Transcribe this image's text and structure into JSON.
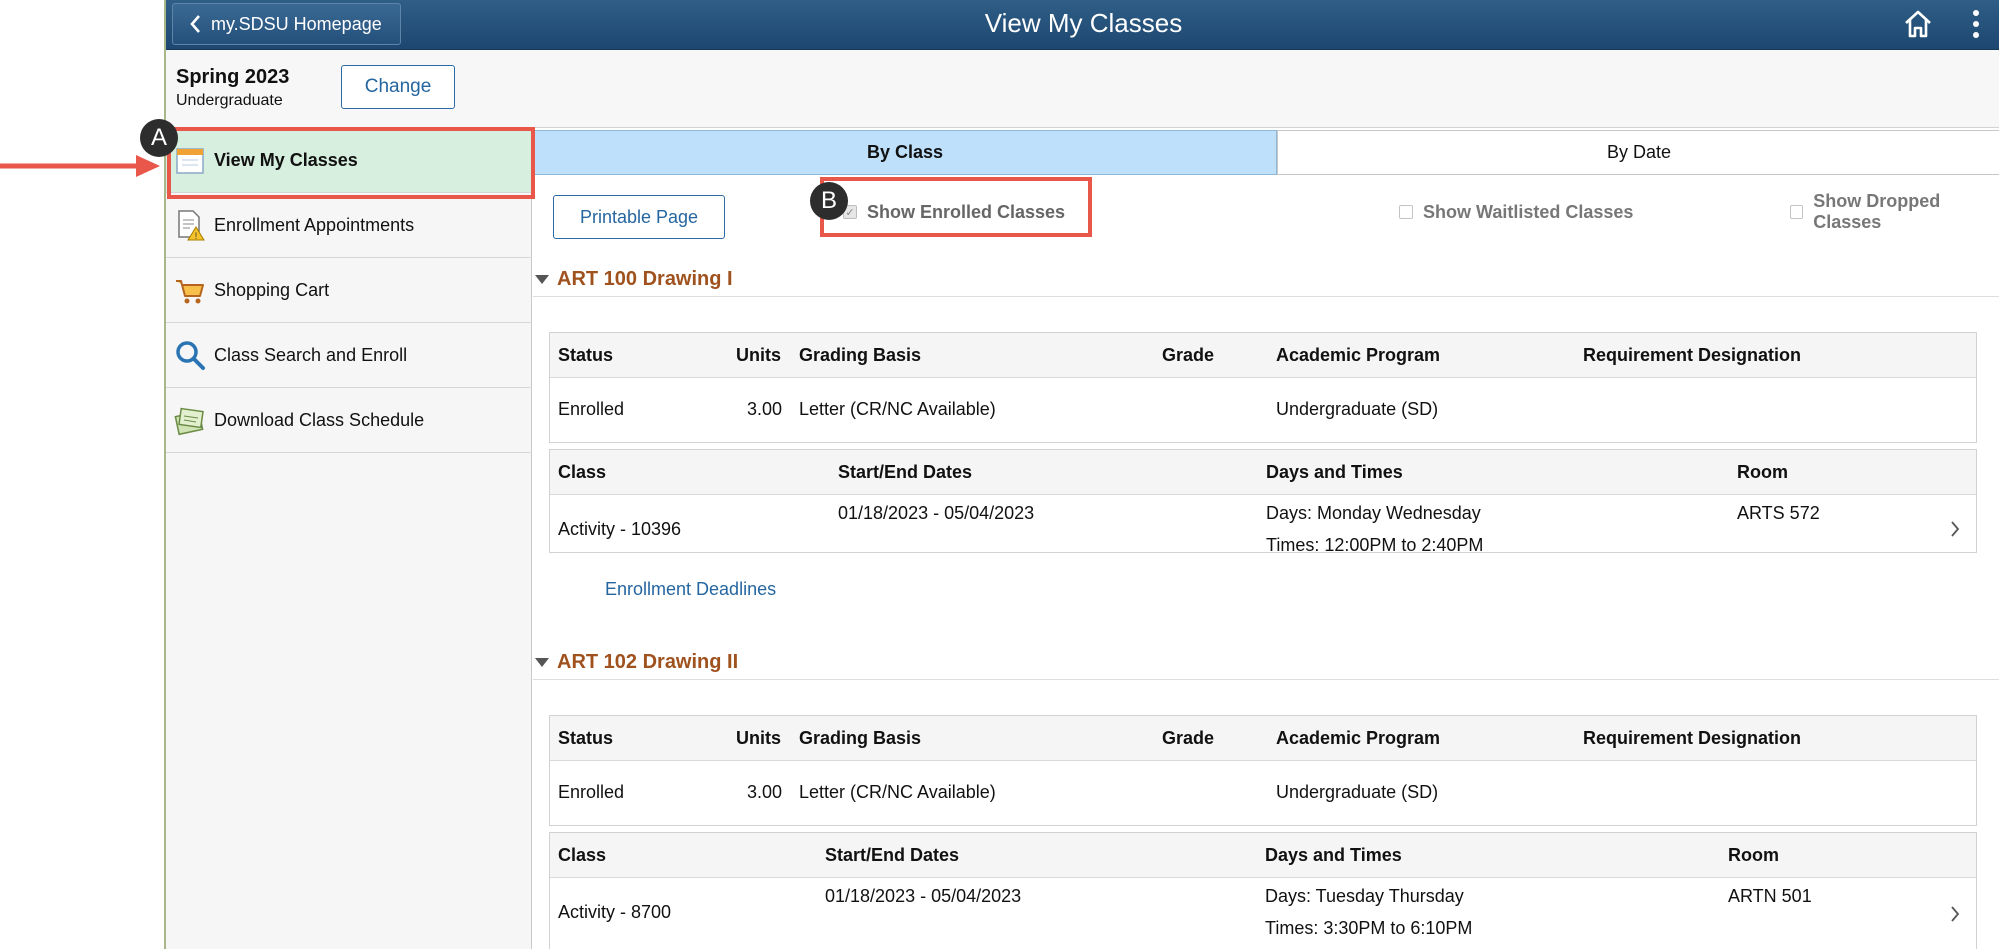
{
  "header": {
    "back_label": "my.SDSU Homepage",
    "title": "View My Classes"
  },
  "term": {
    "name": "Spring 2023",
    "career": "Undergraduate",
    "change_label": "Change"
  },
  "sidebar": {
    "items": [
      {
        "label": "View My Classes",
        "icon": "calendar-icon"
      },
      {
        "label": "Enrollment Appointments",
        "icon": "document-warning-icon"
      },
      {
        "label": "Shopping Cart",
        "icon": "cart-icon"
      },
      {
        "label": "Class Search and Enroll",
        "icon": "search-icon"
      },
      {
        "label": "Download Class Schedule",
        "icon": "download-schedule-icon"
      }
    ]
  },
  "tabs": {
    "by_class": "By Class",
    "by_date": "By Date"
  },
  "toolbar": {
    "printable_label": "Printable Page",
    "show_enrolled": "Show Enrolled Classes",
    "show_waitlisted": "Show Waitlisted Classes",
    "show_dropped": "Show Dropped Classes",
    "show_enrolled_checked": true,
    "show_waitlisted_checked": false,
    "show_dropped_checked": false
  },
  "enrollment_headers": {
    "status": "Status",
    "units": "Units",
    "grading": "Grading Basis",
    "grade": "Grade",
    "program": "Academic Program",
    "requirement": "Requirement Designation"
  },
  "section_headers": {
    "class": "Class",
    "dates": "Start/End Dates",
    "days_times": "Days and Times",
    "room": "Room"
  },
  "courses": [
    {
      "title": "ART 100 Drawing I",
      "status": "Enrolled",
      "units": "3.00",
      "grading": "Letter (CR/NC Available)",
      "grade": "",
      "program": "Undergraduate (SD)",
      "requirement": "",
      "class": "Activity - 10396",
      "dates": "01/18/2023 - 05/04/2023",
      "days": "Days: Monday Wednesday",
      "times": "Times: 12:00PM to 2:40PM",
      "room": "ARTS 572",
      "deadlines_label": "Enrollment Deadlines"
    },
    {
      "title": "ART 102 Drawing II",
      "status": "Enrolled",
      "units": "3.00",
      "grading": "Letter (CR/NC Available)",
      "grade": "",
      "program": "Undergraduate (SD)",
      "requirement": "",
      "class": "Activity - 8700",
      "dates": "01/18/2023 - 05/04/2023",
      "days": "Days: Tuesday Thursday",
      "times": "Times: 3:30PM to 6:10PM",
      "room": "ARTN 501"
    }
  ],
  "annotations": {
    "a": "A",
    "b": "B",
    "highlight_color": "#e9564a"
  }
}
